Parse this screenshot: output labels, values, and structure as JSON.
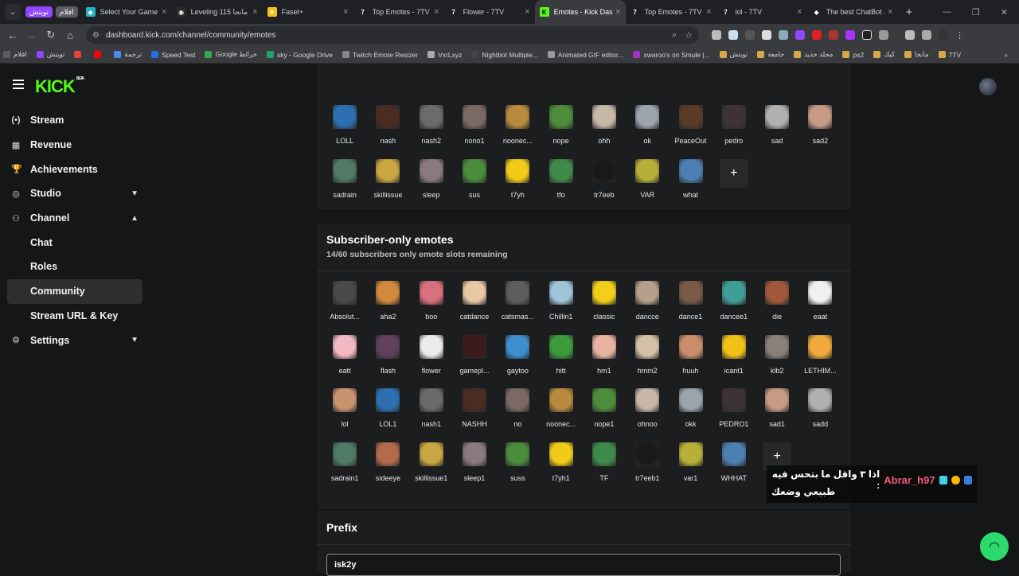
{
  "browser": {
    "pinned": [
      {
        "label": "تويتش",
        "color": "#9146ff"
      },
      {
        "label": "افلام",
        "color": "#5b5d62"
      }
    ],
    "tabs": [
      {
        "title": "Select Your Game S",
        "fav": "#28b4c8",
        "glyph": "◆"
      },
      {
        "title": "Leveling 115 مانجا",
        "fav": "#2a2a2a",
        "glyph": "◉"
      },
      {
        "title": "Fasel+",
        "fav": "#f3c31b",
        "glyph": "♥"
      },
      {
        "title": "Top Emotes - 7TV",
        "fav": "#1f2023",
        "glyph": "7"
      },
      {
        "title": "Flower - 7TV",
        "fav": "#1f2023",
        "glyph": "7"
      },
      {
        "title": "Emotes - Kick Dash",
        "fav": "#53fc18",
        "glyph": "K",
        "active": true
      },
      {
        "title": "Top Emotes - 7TV",
        "fav": "#1f2023",
        "glyph": "7"
      },
      {
        "title": "lol - 7TV",
        "fav": "#1f2023",
        "glyph": "7"
      },
      {
        "title": "The best ChatBot a",
        "fav": "#1f2023",
        "glyph": "◆"
      }
    ],
    "url": "dashboard.kick.com/channel/community/emotes",
    "bookmarks": [
      {
        "label": "افلام",
        "color": "#5b5d62"
      },
      {
        "label": "تويتش",
        "color": "#9146ff"
      },
      {
        "label": "",
        "color": "#e5443a"
      },
      {
        "label": "",
        "color": "#ff0000"
      },
      {
        "label": "ترجمة",
        "color": "#4a8af4"
      },
      {
        "label": "Speed Test",
        "color": "#2b6be9"
      },
      {
        "label": "Google خرائط",
        "color": "#34a853"
      },
      {
        "label": "sky - Google Drive",
        "color": "#1fa463"
      },
      {
        "label": "Twitch Emote Resizer",
        "color": "#888888"
      },
      {
        "label": "VxrLxyz",
        "color": "#aaaaaa"
      },
      {
        "label": "Nightbot Multiple...",
        "color": "#444444"
      },
      {
        "label": "Animated GIF editor...",
        "color": "#999999"
      },
      {
        "label": "xwaroo's on Smule |...",
        "color": "#a033c8"
      },
      {
        "label": "تويتش",
        "color": "#d4a94b"
      },
      {
        "label": "جامعة",
        "color": "#d4a94b"
      },
      {
        "label": "مجلد جديد",
        "color": "#d4a94b"
      },
      {
        "label": "ps2",
        "color": "#d4a94b"
      },
      {
        "label": "كيك",
        "color": "#d4a94b"
      },
      {
        "label": "مانجا",
        "color": "#d4a94b"
      },
      {
        "label": "7TV",
        "color": "#d4a94b"
      }
    ]
  },
  "app": {
    "logo": "KICK",
    "logo_badge": "BETA",
    "sidebar": [
      {
        "label": "Stream",
        "icon": "(•)",
        "name": "stream"
      },
      {
        "label": "Revenue",
        "icon": "▦",
        "name": "revenue"
      },
      {
        "label": "Achievements",
        "icon": "🏆",
        "name": "achievements"
      },
      {
        "label": "Studio",
        "icon": "◎",
        "name": "studio",
        "chev": "▼"
      },
      {
        "label": "Channel",
        "icon": "⚇",
        "name": "channel",
        "chev": "▲"
      },
      {
        "label": "Chat",
        "sub": true,
        "name": "chat"
      },
      {
        "label": "Roles",
        "sub": true,
        "name": "roles"
      },
      {
        "label": "Community",
        "sub": true,
        "name": "community",
        "active": true
      },
      {
        "label": "Stream URL & Key",
        "sub": true,
        "name": "stream-url-key"
      },
      {
        "label": "Settings",
        "icon": "⚙",
        "name": "settings",
        "chev": "▼"
      }
    ]
  },
  "channel_emotes": [
    {
      "name": "LOLL",
      "color": "#2e6fb2"
    },
    {
      "name": "nash",
      "color": "#4a2d22"
    },
    {
      "name": "nash2",
      "color": "#6b6b6b"
    },
    {
      "name": "nono1",
      "color": "#7b6a63"
    },
    {
      "name": "noonec...",
      "color": "#b78a3e"
    },
    {
      "name": "nope",
      "color": "#4d8c3a"
    },
    {
      "name": "ohh",
      "color": "#c7b7a6"
    },
    {
      "name": "ok",
      "color": "#9ca4ae"
    },
    {
      "name": "PeaceOut",
      "color": "#5a3b26"
    },
    {
      "name": "pedro",
      "color": "#3d3238"
    },
    {
      "name": "sad",
      "color": "#b0b0b0"
    },
    {
      "name": "sad2",
      "color": "#c79a86"
    },
    {
      "name": "sadrain",
      "color": "#4f7a66"
    },
    {
      "name": "skillissue",
      "color": "#c9a642"
    },
    {
      "name": "sleep",
      "color": "#8a7a80"
    },
    {
      "name": "sus",
      "color": "#4b8b3c"
    },
    {
      "name": "t7yh",
      "color": "#f2cb18"
    },
    {
      "name": "tfo",
      "color": "#3d8a4a"
    },
    {
      "name": "tr7eeb",
      "color": "#1a1a1a"
    },
    {
      "name": "VAR",
      "color": "#b7b038"
    },
    {
      "name": "what",
      "color": "#4c7fb3"
    },
    {
      "add": true,
      "name": "+"
    }
  ],
  "subscriber_section": {
    "title": "Subscriber-only emotes",
    "subtitle": "14/60 subscribers only emote slots remaining"
  },
  "subscriber_emotes": [
    {
      "name": "Absolut...",
      "color": "#4a4a4a"
    },
    {
      "name": "aha2",
      "color": "#d18a3c"
    },
    {
      "name": "boo",
      "color": "#d9707e"
    },
    {
      "name": "catdance",
      "color": "#e7c8a5"
    },
    {
      "name": "catsmas...",
      "color": "#5e5e5e"
    },
    {
      "name": "Chillin1",
      "color": "#9fc3d9"
    },
    {
      "name": "classic",
      "color": "#f2cf1a"
    },
    {
      "name": "dancce",
      "color": "#b5a08b"
    },
    {
      "name": "dance1",
      "color": "#7a5a4a"
    },
    {
      "name": "dancee1",
      "color": "#3f9e96"
    },
    {
      "name": "die",
      "color": "#a0583a"
    },
    {
      "name": "eaat",
      "color": "#f0f0f0"
    },
    {
      "name": "eatt",
      "color": "#f3b8c4"
    },
    {
      "name": "flash",
      "color": "#60405a"
    },
    {
      "name": "flower",
      "color": "#ececec"
    },
    {
      "name": "gamepl...",
      "color": "#3a1a1a"
    },
    {
      "name": "gaytoo",
      "color": "#3d8fd0"
    },
    {
      "name": "hitt",
      "color": "#3c9a3a"
    },
    {
      "name": "hm1",
      "color": "#e9b3a3"
    },
    {
      "name": "hmm2",
      "color": "#d4c0a8"
    },
    {
      "name": "huuh",
      "color": "#c98d6b"
    },
    {
      "name": "icant1",
      "color": "#f1c118"
    },
    {
      "name": "klb2",
      "color": "#8a807a"
    },
    {
      "name": "LETHIM...",
      "color": "#f0a93a"
    },
    {
      "name": "lol",
      "color": "#c9936e"
    },
    {
      "name": "LOL1",
      "color": "#2e6fb2"
    },
    {
      "name": "nash1",
      "color": "#6a6a6a"
    },
    {
      "name": "NASHH",
      "color": "#4a2d22"
    },
    {
      "name": "no",
      "color": "#7b6a63"
    },
    {
      "name": "noonec...",
      "color": "#b78a3e"
    },
    {
      "name": "nope1",
      "color": "#4d8c3a"
    },
    {
      "name": "ohnoo",
      "color": "#c7b7a6"
    },
    {
      "name": "okk",
      "color": "#9ca4ae"
    },
    {
      "name": "PEDRO1",
      "color": "#3d3238"
    },
    {
      "name": "sad1",
      "color": "#c79a86"
    },
    {
      "name": "sadd",
      "color": "#b0b0b0"
    },
    {
      "name": "sadrain1",
      "color": "#4f7a66"
    },
    {
      "name": "sideeye",
      "color": "#b46a4c"
    },
    {
      "name": "skillissue1",
      "color": "#c9a642"
    },
    {
      "name": "sleep1",
      "color": "#8a7a80"
    },
    {
      "name": "suss",
      "color": "#4b8b3c"
    },
    {
      "name": "t7yh1",
      "color": "#f2cb18"
    },
    {
      "name": "TF",
      "color": "#3d8a4a"
    },
    {
      "name": "tr7eeb1",
      "color": "#1a1a1a"
    },
    {
      "name": "var1",
      "color": "#b7b038"
    },
    {
      "name": "WHHAT",
      "color": "#4c7fb3"
    },
    {
      "add": true,
      "name": "+"
    }
  ],
  "prefix": {
    "title": "Prefix",
    "value": "isk2y"
  },
  "overlay": {
    "username": "Abrar_h97",
    "message_part1": "اذا ٣ واقل ما بتحس فيه :",
    "message_part2": "طبيعي وضعك"
  }
}
